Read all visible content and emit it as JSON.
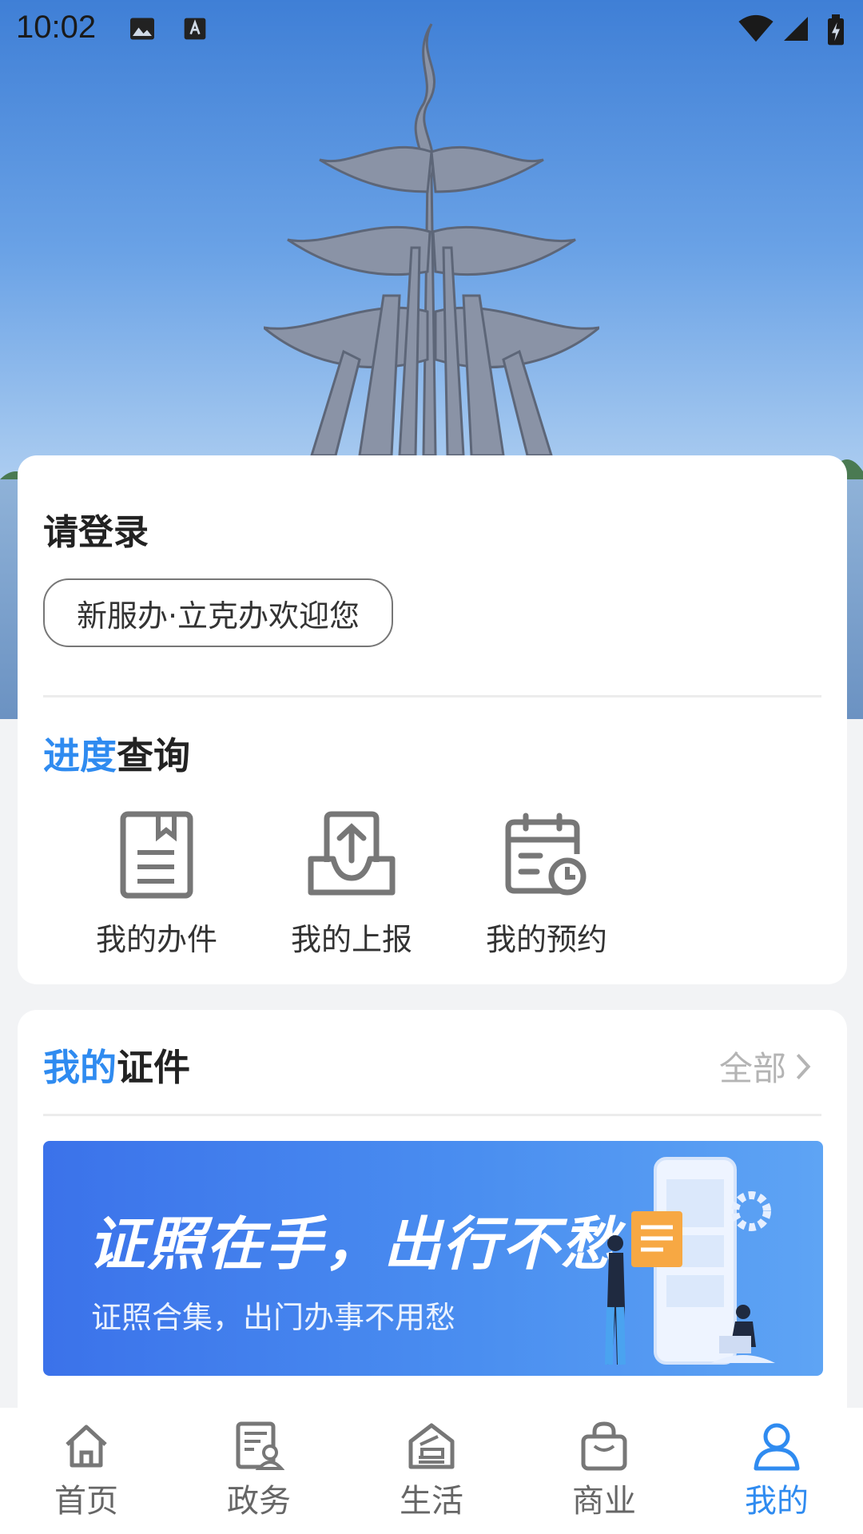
{
  "status_bar": {
    "time": "10:02"
  },
  "login": {
    "title": "请登录",
    "welcome": "新服办·立克办欢迎您"
  },
  "progress": {
    "title_accent": "进度",
    "title_rest": "查询",
    "items": [
      {
        "label": "我的办件",
        "icon": "document-icon"
      },
      {
        "label": "我的上报",
        "icon": "upload-tray-icon"
      },
      {
        "label": "我的预约",
        "icon": "calendar-clock-icon"
      }
    ]
  },
  "certificates": {
    "title_accent": "我的",
    "title_rest": "证件",
    "all_label": "全部",
    "banner_title": "证照在手，出行不愁",
    "banner_subtitle": "证照合集，出门办事不用愁"
  },
  "nav": {
    "items": [
      {
        "label": "首页",
        "icon": "home-icon"
      },
      {
        "label": "政务",
        "icon": "government-doc-icon"
      },
      {
        "label": "生活",
        "icon": "life-icon"
      },
      {
        "label": "商业",
        "icon": "shopping-bag-icon"
      },
      {
        "label": "我的",
        "icon": "user-icon",
        "active": true
      }
    ]
  },
  "colors": {
    "accent": "#2f8bf0",
    "banner": "#3b72ea"
  }
}
